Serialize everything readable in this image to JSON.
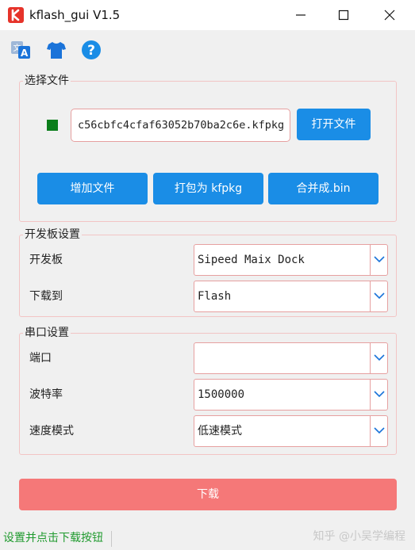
{
  "window": {
    "title": "kflash_gui V1.5"
  },
  "toolbar": {
    "icons": [
      "language-icon",
      "theme-shirt-icon",
      "help-icon"
    ]
  },
  "file_group": {
    "title": "选择文件",
    "status_color": "#0a7d1a",
    "file_path": "c56cbfc4cfaf63052b70ba2c6e.kfpkg",
    "open_label": "打开文件",
    "add_label": "增加文件",
    "pack_label": "打包为 kfpkg",
    "merge_label": "合并成.bin"
  },
  "board_group": {
    "title": "开发板设置",
    "board_label": "开发板",
    "board_value": "Sipeed Maix Dock",
    "target_label": "下载到",
    "target_value": "Flash"
  },
  "serial_group": {
    "title": "串口设置",
    "port_label": "端口",
    "port_value": "",
    "baud_label": "波特率",
    "baud_value": "1500000",
    "speed_label": "速度模式",
    "speed_value": "低速模式"
  },
  "download": {
    "label": "下载"
  },
  "statusbar": {
    "message": "设置并点击下载按钮",
    "watermark": "知乎 @小吴学编程"
  },
  "colors": {
    "accent": "#1a8de6",
    "download": "#f57878",
    "border": "#e6a0a0",
    "status_text": "#1f9a2e"
  }
}
